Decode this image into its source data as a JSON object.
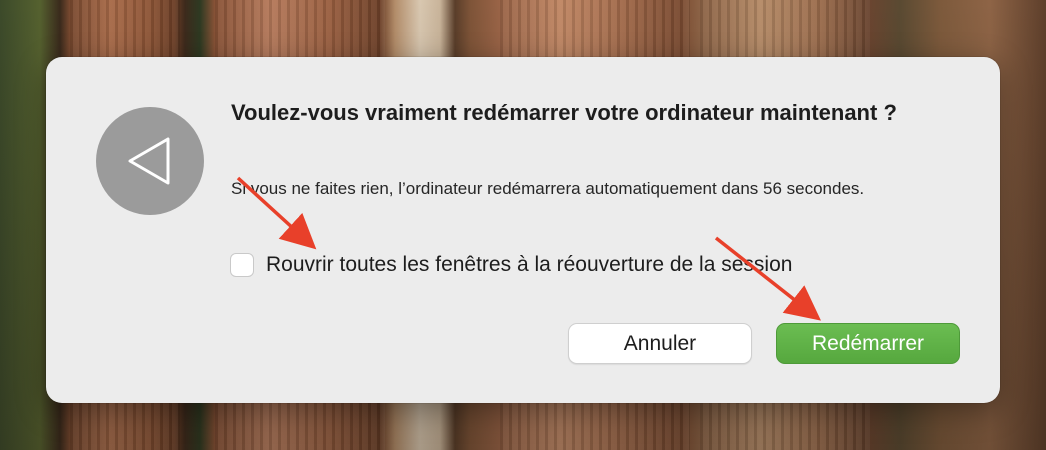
{
  "dialog": {
    "title": "Voulez-vous vraiment redémarrer votre ordinateur maintenant ?",
    "message": "Si vous ne faites rien, l’ordinateur redémarrera automatiquement dans 56 secondes.",
    "icon": "restart-triangle-icon",
    "checkbox": {
      "label": "Rouvrir toutes les fenêtres à la réouverture de la session",
      "checked": false
    },
    "buttons": {
      "cancel_label": "Annuler",
      "confirm_label": "Redémarrer"
    }
  },
  "colors": {
    "dialog_bg": "#ececec",
    "confirm_button": "#5cb043",
    "annotation_arrow": "#e8402a"
  },
  "annotations": [
    "arrow-to-checkbox",
    "arrow-to-restart-button"
  ]
}
